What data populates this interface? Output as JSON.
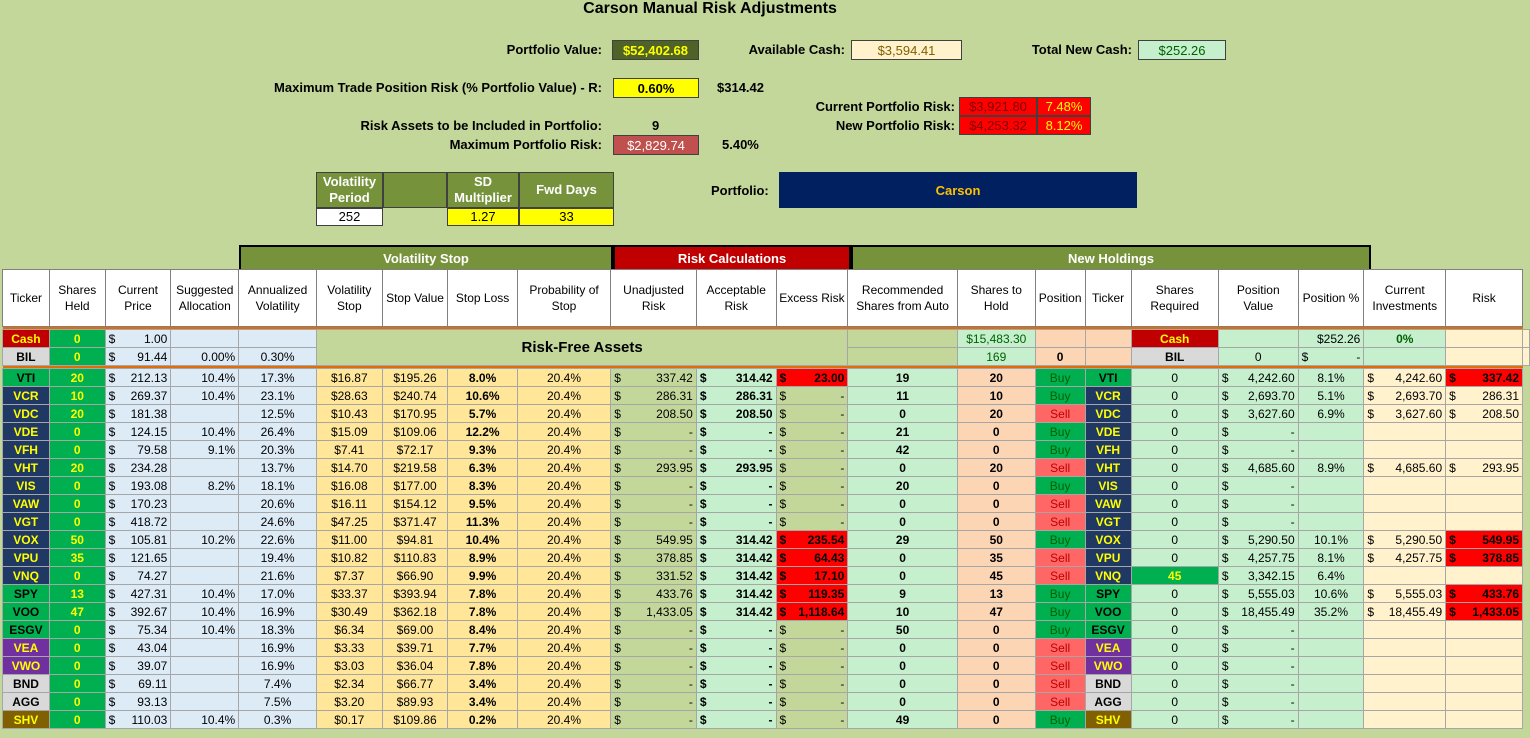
{
  "title": "Carson Manual Risk Adjustments",
  "summary": {
    "portfolio_value_label": "Portfolio Value:",
    "portfolio_value": "$52,402.68",
    "available_cash_label": "Available Cash:",
    "available_cash": "$3,594.41",
    "total_new_cash_label": "Total New Cash:",
    "total_new_cash": "$252.26",
    "max_trade_label": "Maximum Trade Position Risk (% Portfolio Value) - R:",
    "max_trade_pct": "0.60%",
    "max_trade_amount": "$314.42",
    "risk_assets_label": "Risk Assets to be Included in Portfolio:",
    "risk_assets_count": "9",
    "max_portfolio_risk_label": "Maximum Portfolio Risk:",
    "max_portfolio_risk": "$2,829.74",
    "max_portfolio_risk_pct": "5.40%",
    "current_risk_label": "Current Portfolio Risk:",
    "current_risk_amount": "$3,921.80",
    "current_risk_pct": "7.48%",
    "new_risk_label": "New Portfolio Risk:",
    "new_risk_amount": "$4,253.32",
    "new_risk_pct": "8.12%",
    "portfolio_label": "Portfolio:",
    "portfolio_name": "Carson"
  },
  "vol_params": {
    "period_label": "Volatility Period",
    "period_value": "252",
    "sd_label": "SD Multiplier",
    "sd_value": "1.27",
    "fwd_label": "Fwd Days",
    "fwd_value": "33"
  },
  "sections": {
    "volatility_stop": "Volatility Stop",
    "risk_calculations": "Risk Calculations",
    "new_holdings": "New Holdings",
    "risk_free": "Risk-Free Assets"
  },
  "headers": [
    "Ticker",
    "Shares Held",
    "Current Price",
    "Suggested Allocation",
    "Annualized Volatility",
    "Volatility Stop",
    "Stop Value",
    "Stop Loss",
    "Probability of Stop",
    "Unadjusted Risk",
    "Acceptable Risk",
    "Excess Risk",
    "Recommended Shares from Auto",
    "Shares to Hold",
    "Position",
    "Ticker",
    "Shares Required",
    "Position Value",
    "Position %",
    "Current Investments",
    "Risk"
  ],
  "cash_row": {
    "ticker": "Cash",
    "shares": "0",
    "price": "1.00",
    "recommended": "$15,483.30",
    "ticker2": "Cash",
    "position_value": "$252.26",
    "position_pct": "0%"
  },
  "bil_row": {
    "ticker": "BIL",
    "shares": "0",
    "price": "91.44",
    "alloc": "0.00%",
    "vol": "0.30%",
    "recommended": "169",
    "hold": "0",
    "ticker2": "BIL",
    "required": "0"
  },
  "rows": [
    {
      "t": "VTI",
      "sh": "20",
      "pr": "212.13",
      "al": "10.4%",
      "av": "17.3%",
      "vs": "$16.87",
      "sv": "$195.26",
      "sl": "8.0%",
      "ps": "20.4%",
      "ur": "337.42",
      "ar": "314.42",
      "er": "23.00",
      "rec": "19",
      "hold": "20",
      "pos": "Buy",
      "req": "0",
      "pv": "4,242.60",
      "pp": "8.1%",
      "ci": "4,242.60",
      "risk": "337.42"
    },
    {
      "t": "VCR",
      "sh": "10",
      "pr": "269.37",
      "al": "10.4%",
      "av": "23.1%",
      "vs": "$28.63",
      "sv": "$240.74",
      "sl": "10.6%",
      "ps": "20.4%",
      "ur": "286.31",
      "ar": "286.31",
      "er": "-",
      "rec": "11",
      "hold": "10",
      "pos": "Buy",
      "req": "0",
      "pv": "2,693.70",
      "pp": "5.1%",
      "ci": "2,693.70",
      "risk": "286.31"
    },
    {
      "t": "VDC",
      "sh": "20",
      "pr": "181.38",
      "al": "",
      "av": "12.5%",
      "vs": "$10.43",
      "sv": "$170.95",
      "sl": "5.7%",
      "ps": "20.4%",
      "ur": "208.50",
      "ar": "208.50",
      "er": "-",
      "rec": "0",
      "hold": "20",
      "pos": "Sell",
      "req": "0",
      "pv": "3,627.60",
      "pp": "6.9%",
      "ci": "3,627.60",
      "risk": "208.50"
    },
    {
      "t": "VDE",
      "sh": "0",
      "pr": "124.15",
      "al": "10.4%",
      "av": "26.4%",
      "vs": "$15.09",
      "sv": "$109.06",
      "sl": "12.2%",
      "ps": "20.4%",
      "ur": "-",
      "ar": "-",
      "er": "-",
      "rec": "21",
      "hold": "0",
      "pos": "Buy",
      "req": "0",
      "pv": "-",
      "pp": "",
      "ci": "",
      "risk": ""
    },
    {
      "t": "VFH",
      "sh": "0",
      "pr": "79.58",
      "al": "9.1%",
      "av": "20.3%",
      "vs": "$7.41",
      "sv": "$72.17",
      "sl": "9.3%",
      "ps": "20.4%",
      "ur": "-",
      "ar": "-",
      "er": "-",
      "rec": "42",
      "hold": "0",
      "pos": "Buy",
      "req": "0",
      "pv": "-",
      "pp": "",
      "ci": "",
      "risk": ""
    },
    {
      "t": "VHT",
      "sh": "20",
      "pr": "234.28",
      "al": "",
      "av": "13.7%",
      "vs": "$14.70",
      "sv": "$219.58",
      "sl": "6.3%",
      "ps": "20.4%",
      "ur": "293.95",
      "ar": "293.95",
      "er": "-",
      "rec": "0",
      "hold": "20",
      "pos": "Sell",
      "req": "0",
      "pv": "4,685.60",
      "pp": "8.9%",
      "ci": "4,685.60",
      "risk": "293.95"
    },
    {
      "t": "VIS",
      "sh": "0",
      "pr": "193.08",
      "al": "8.2%",
      "av": "18.1%",
      "vs": "$16.08",
      "sv": "$177.00",
      "sl": "8.3%",
      "ps": "20.4%",
      "ur": "-",
      "ar": "-",
      "er": "-",
      "rec": "20",
      "hold": "0",
      "pos": "Buy",
      "req": "0",
      "pv": "-",
      "pp": "",
      "ci": "",
      "risk": ""
    },
    {
      "t": "VAW",
      "sh": "0",
      "pr": "170.23",
      "al": "",
      "av": "20.6%",
      "vs": "$16.11",
      "sv": "$154.12",
      "sl": "9.5%",
      "ps": "20.4%",
      "ur": "-",
      "ar": "-",
      "er": "-",
      "rec": "0",
      "hold": "0",
      "pos": "Sell",
      "req": "0",
      "pv": "-",
      "pp": "",
      "ci": "",
      "risk": ""
    },
    {
      "t": "VGT",
      "sh": "0",
      "pr": "418.72",
      "al": "",
      "av": "24.6%",
      "vs": "$47.25",
      "sv": "$371.47",
      "sl": "11.3%",
      "ps": "20.4%",
      "ur": "-",
      "ar": "-",
      "er": "-",
      "rec": "0",
      "hold": "0",
      "pos": "Sell",
      "req": "0",
      "pv": "-",
      "pp": "",
      "ci": "",
      "risk": ""
    },
    {
      "t": "VOX",
      "sh": "50",
      "pr": "105.81",
      "al": "10.2%",
      "av": "22.6%",
      "vs": "$11.00",
      "sv": "$94.81",
      "sl": "10.4%",
      "ps": "20.4%",
      "ur": "549.95",
      "ar": "314.42",
      "er": "235.54",
      "rec": "29",
      "hold": "50",
      "pos": "Buy",
      "req": "0",
      "pv": "5,290.50",
      "pp": "10.1%",
      "ci": "5,290.50",
      "risk": "549.95"
    },
    {
      "t": "VPU",
      "sh": "35",
      "pr": "121.65",
      "al": "",
      "av": "19.4%",
      "vs": "$10.82",
      "sv": "$110.83",
      "sl": "8.9%",
      "ps": "20.4%",
      "ur": "378.85",
      "ar": "314.42",
      "er": "64.43",
      "rec": "0",
      "hold": "35",
      "pos": "Sell",
      "req": "0",
      "pv": "4,257.75",
      "pp": "8.1%",
      "ci": "4,257.75",
      "risk": "378.85"
    },
    {
      "t": "VNQ",
      "sh": "0",
      "pr": "74.27",
      "al": "",
      "av": "21.6%",
      "vs": "$7.37",
      "sv": "$66.90",
      "sl": "9.9%",
      "ps": "20.4%",
      "ur": "331.52",
      "ar": "314.42",
      "er": "17.10",
      "rec": "0",
      "hold": "45",
      "pos": "Sell",
      "req": "45",
      "pv": "3,342.15",
      "pp": "6.4%",
      "ci": "",
      "risk": ""
    },
    {
      "t": "SPY",
      "sh": "13",
      "pr": "427.31",
      "al": "10.4%",
      "av": "17.0%",
      "vs": "$33.37",
      "sv": "$393.94",
      "sl": "7.8%",
      "ps": "20.4%",
      "ur": "433.76",
      "ar": "314.42",
      "er": "119.35",
      "rec": "9",
      "hold": "13",
      "pos": "Buy",
      "req": "0",
      "pv": "5,555.03",
      "pp": "10.6%",
      "ci": "5,555.03",
      "risk": "433.76"
    },
    {
      "t": "VOO",
      "sh": "47",
      "pr": "392.67",
      "al": "10.4%",
      "av": "16.9%",
      "vs": "$30.49",
      "sv": "$362.18",
      "sl": "7.8%",
      "ps": "20.4%",
      "ur": "1,433.05",
      "ar": "314.42",
      "er": "1,118.64",
      "rec": "10",
      "hold": "47",
      "pos": "Buy",
      "req": "0",
      "pv": "18,455.49",
      "pp": "35.2%",
      "ci": "18,455.49",
      "risk": "1,433.05"
    },
    {
      "t": "ESGV",
      "sh": "0",
      "pr": "75.34",
      "al": "10.4%",
      "av": "18.3%",
      "vs": "$6.34",
      "sv": "$69.00",
      "sl": "8.4%",
      "ps": "20.4%",
      "ur": "-",
      "ar": "-",
      "er": "-",
      "rec": "50",
      "hold": "0",
      "pos": "Buy",
      "req": "0",
      "pv": "-",
      "pp": "",
      "ci": "",
      "risk": ""
    },
    {
      "t": "VEA",
      "sh": "0",
      "pr": "43.04",
      "al": "",
      "av": "16.9%",
      "vs": "$3.33",
      "sv": "$39.71",
      "sl": "7.7%",
      "ps": "20.4%",
      "ur": "-",
      "ar": "-",
      "er": "-",
      "rec": "0",
      "hold": "0",
      "pos": "Sell",
      "req": "0",
      "pv": "-",
      "pp": "",
      "ci": "",
      "risk": ""
    },
    {
      "t": "VWO",
      "sh": "0",
      "pr": "39.07",
      "al": "",
      "av": "16.9%",
      "vs": "$3.03",
      "sv": "$36.04",
      "sl": "7.8%",
      "ps": "20.4%",
      "ur": "-",
      "ar": "-",
      "er": "-",
      "rec": "0",
      "hold": "0",
      "pos": "Sell",
      "req": "0",
      "pv": "-",
      "pp": "",
      "ci": "",
      "risk": ""
    },
    {
      "t": "BND",
      "sh": "0",
      "pr": "69.11",
      "al": "",
      "av": "7.4%",
      "vs": "$2.34",
      "sv": "$66.77",
      "sl": "3.4%",
      "ps": "20.4%",
      "ur": "-",
      "ar": "-",
      "er": "-",
      "rec": "0",
      "hold": "0",
      "pos": "Sell",
      "req": "0",
      "pv": "-",
      "pp": "",
      "ci": "",
      "risk": ""
    },
    {
      "t": "AGG",
      "sh": "0",
      "pr": "93.13",
      "al": "",
      "av": "7.5%",
      "vs": "$3.20",
      "sv": "$89.93",
      "sl": "3.4%",
      "ps": "20.4%",
      "ur": "-",
      "ar": "-",
      "er": "-",
      "rec": "0",
      "hold": "0",
      "pos": "Sell",
      "req": "0",
      "pv": "-",
      "pp": "",
      "ci": "",
      "risk": ""
    },
    {
      "t": "SHV",
      "sh": "0",
      "pr": "110.03",
      "al": "10.4%",
      "av": "0.3%",
      "vs": "$0.17",
      "sv": "$109.86",
      "sl": "0.2%",
      "ps": "20.4%",
      "ur": "-",
      "ar": "-",
      "er": "-",
      "rec": "49",
      "hold": "0",
      "pos": "Buy",
      "req": "0",
      "pv": "-",
      "pp": "",
      "ci": "",
      "risk": ""
    }
  ],
  "ticker_colors": {
    "VTI": "g",
    "VCR": "n",
    "VDC": "n",
    "VDE": "n",
    "VFH": "n",
    "VHT": "n",
    "VIS": "n",
    "VAW": "n",
    "VGT": "n",
    "VOX": "n",
    "VPU": "n",
    "VNQ": "n",
    "SPY": "g",
    "VOO": "g",
    "ESGV": "g",
    "VEA": "p",
    "VWO": "p",
    "BND": "w",
    "AGG": "w",
    "SHV": "br"
  }
}
